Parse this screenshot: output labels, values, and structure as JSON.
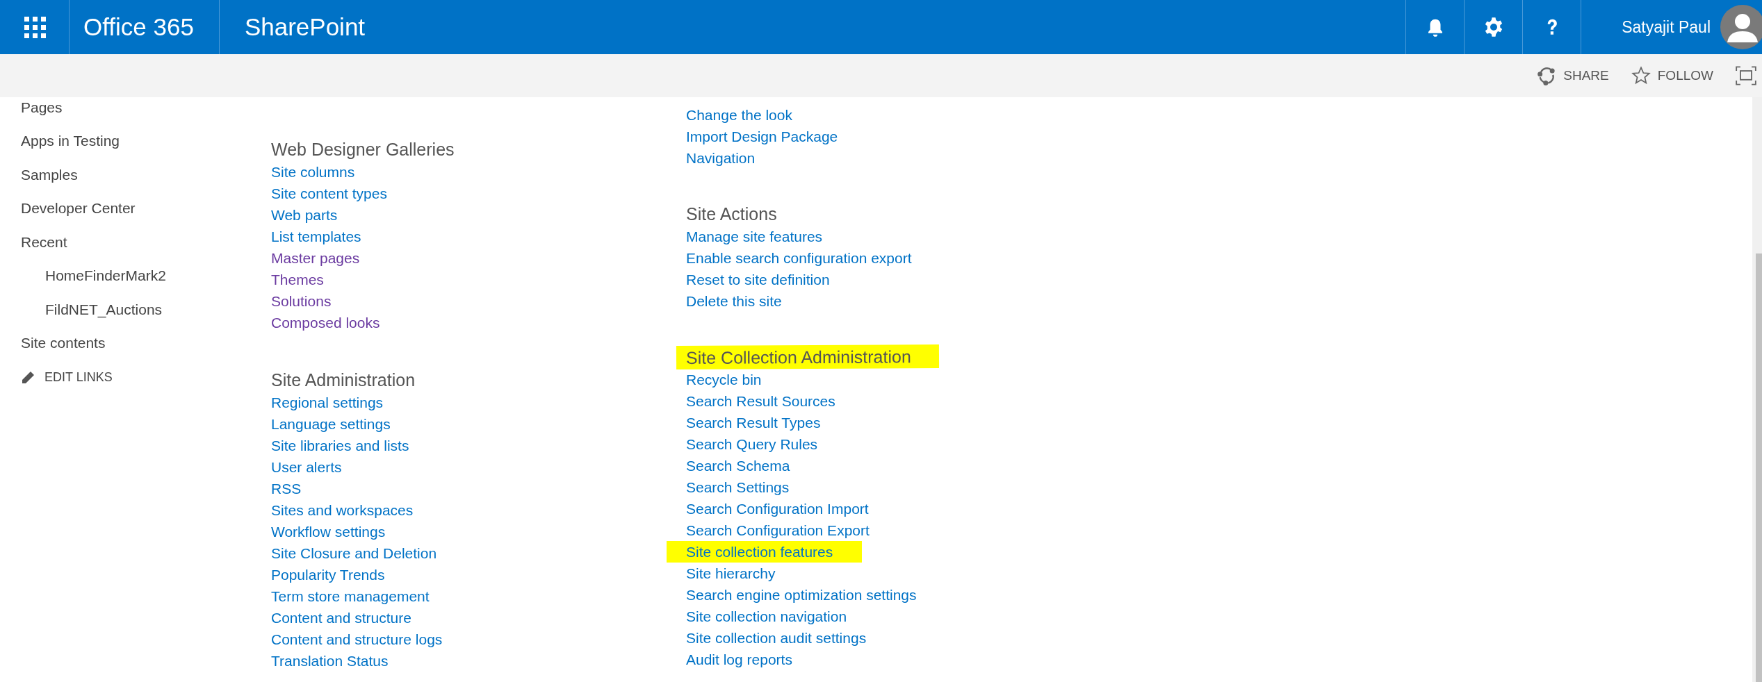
{
  "suite_bar": {
    "brand": "Office 365",
    "app": "SharePoint",
    "user": "Satyajit Paul"
  },
  "actions": [
    {
      "kind": "share",
      "label": "SHARE"
    },
    {
      "kind": "follow",
      "label": "FOLLOW"
    },
    {
      "kind": "focus"
    }
  ],
  "left_nav": {
    "items": [
      {
        "label": "Pages"
      },
      {
        "label": "Apps in Testing"
      },
      {
        "label": "Samples"
      },
      {
        "label": "Developer Center"
      },
      {
        "label": "Recent",
        "children": [
          {
            "label": "HomeFinderMark2"
          },
          {
            "label": "FildNET_Auctions"
          }
        ]
      },
      {
        "label": "Site contents"
      }
    ],
    "edit_links": "EDIT LINKS"
  },
  "columns": [
    [
      {
        "title": "Web Designer Galleries",
        "highlighted": false,
        "links": [
          {
            "label": "Site columns",
            "visited": false,
            "highlighted": false
          },
          {
            "label": "Site content types",
            "visited": false,
            "highlighted": false
          },
          {
            "label": "Web parts",
            "visited": false,
            "highlighted": false
          },
          {
            "label": "List templates",
            "visited": false,
            "highlighted": false
          },
          {
            "label": "Master pages",
            "visited": true,
            "highlighted": false
          },
          {
            "label": "Themes",
            "visited": true,
            "highlighted": false
          },
          {
            "label": "Solutions",
            "visited": true,
            "highlighted": false
          },
          {
            "label": "Composed looks",
            "visited": true,
            "highlighted": false
          }
        ]
      },
      {
        "title": "Site Administration",
        "highlighted": false,
        "links": [
          {
            "label": "Regional settings",
            "visited": false,
            "highlighted": false
          },
          {
            "label": "Language settings",
            "visited": false,
            "highlighted": false
          },
          {
            "label": "Site libraries and lists",
            "visited": false,
            "highlighted": false
          },
          {
            "label": "User alerts",
            "visited": false,
            "highlighted": false
          },
          {
            "label": "RSS",
            "visited": false,
            "highlighted": false
          },
          {
            "label": "Sites and workspaces",
            "visited": false,
            "highlighted": false
          },
          {
            "label": "Workflow settings",
            "visited": false,
            "highlighted": false
          },
          {
            "label": "Site Closure and Deletion",
            "visited": false,
            "highlighted": false
          },
          {
            "label": "Popularity Trends",
            "visited": false,
            "highlighted": false
          },
          {
            "label": "Term store management",
            "visited": false,
            "highlighted": false
          },
          {
            "label": "Content and structure",
            "visited": false,
            "highlighted": false
          },
          {
            "label": "Content and structure logs",
            "visited": false,
            "highlighted": false
          },
          {
            "label": "Translation Status",
            "visited": false,
            "highlighted": false
          }
        ]
      }
    ],
    [
      {
        "links": [
          {
            "label": "Change the look",
            "visited": false,
            "highlighted": false
          },
          {
            "label": "Import Design Package",
            "visited": false,
            "highlighted": false
          },
          {
            "label": "Navigation",
            "visited": false,
            "highlighted": false
          }
        ]
      },
      {
        "title": "Site Actions",
        "highlighted": false,
        "links": [
          {
            "label": "Manage site features",
            "visited": false,
            "highlighted": false
          },
          {
            "label": "Enable search configuration export",
            "visited": false,
            "highlighted": false
          },
          {
            "label": "Reset to site definition",
            "visited": false,
            "highlighted": false
          },
          {
            "label": "Delete this site",
            "visited": false,
            "highlighted": false
          }
        ]
      },
      {
        "title": "Site Collection Administration",
        "highlighted": true,
        "links": [
          {
            "label": "Recycle bin",
            "visited": false,
            "highlighted": false
          },
          {
            "label": "Search Result Sources",
            "visited": false,
            "highlighted": false
          },
          {
            "label": "Search Result Types",
            "visited": false,
            "highlighted": false
          },
          {
            "label": "Search Query Rules",
            "visited": false,
            "highlighted": false
          },
          {
            "label": "Search Schema",
            "visited": false,
            "highlighted": false
          },
          {
            "label": "Search Settings",
            "visited": false,
            "highlighted": false
          },
          {
            "label": "Search Configuration Import",
            "visited": false,
            "highlighted": false
          },
          {
            "label": "Search Configuration Export",
            "visited": false,
            "highlighted": false
          },
          {
            "label": "Site collection features",
            "visited": false,
            "highlighted": true
          },
          {
            "label": "Site hierarchy",
            "visited": false,
            "highlighted": false
          },
          {
            "label": "Search engine optimization settings",
            "visited": false,
            "highlighted": false
          },
          {
            "label": "Site collection navigation",
            "visited": false,
            "highlighted": false
          },
          {
            "label": "Site collection audit settings",
            "visited": false,
            "highlighted": false
          },
          {
            "label": "Audit log reports",
            "visited": false,
            "highlighted": false
          }
        ]
      }
    ]
  ]
}
